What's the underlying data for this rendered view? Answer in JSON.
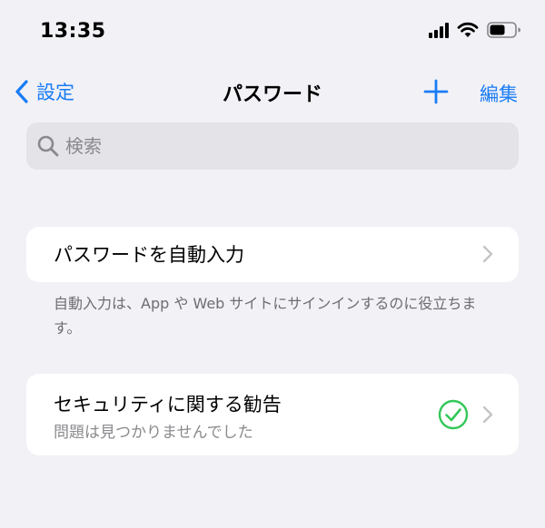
{
  "status_bar": {
    "time": "13:35",
    "icons": [
      "cellular-signal-icon",
      "wifi-icon",
      "battery-icon"
    ]
  },
  "nav": {
    "back_label": "設定",
    "title": "パスワード",
    "edit_label": "編集",
    "icons": [
      "chevron-left-icon",
      "plus-icon"
    ]
  },
  "search": {
    "placeholder": "検索"
  },
  "autofill": {
    "label": "パスワードを自動入力",
    "footnote": "自動入力は、App や Web サイトにサインインするのに役立ちます。"
  },
  "security": {
    "label": "セキュリティに関する勧告",
    "status": "問題は見つかりませんでした",
    "status_icon": "checkmark-circle-icon"
  },
  "colors": {
    "accent": "#1a7cf5",
    "background": "#f1f1f6",
    "success": "#34c759",
    "secondary_text": "#8a8a8e"
  }
}
